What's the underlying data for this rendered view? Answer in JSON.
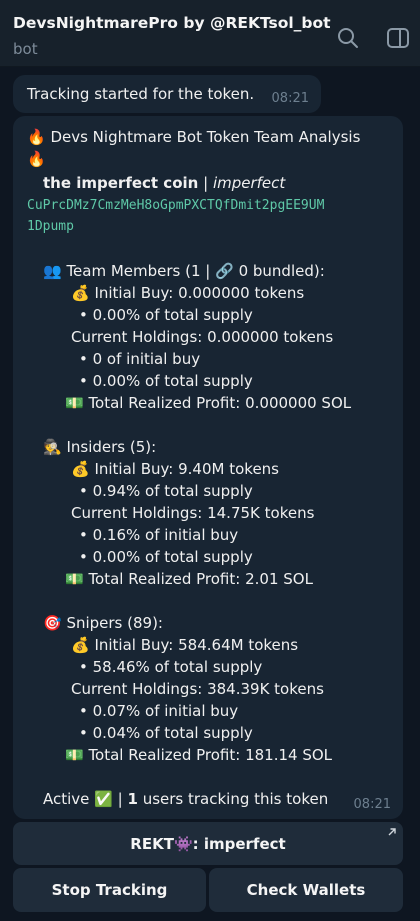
{
  "header": {
    "title": "DevsNightmarePro by @REKTsol_bot",
    "subtitle": "bot"
  },
  "messages": [
    {
      "text": "Tracking started for the token.",
      "time": "08:21"
    }
  ],
  "report": {
    "lines": [
      "🔥 Devs Nightmare Bot Token Team Analysis",
      "🔥",
      "",
      "",
      "",
      "",
      "",
      "👥 Team Members (1 | 🔗 0 bundled):",
      "💰 Initial Buy: 0.000000 tokens",
      "• 0.00% of total supply",
      "Current Holdings: 0.000000 tokens",
      "• 0 of initial buy",
      "• 0.00% of total supply",
      "💵 Total Realized Profit: 0.000000 SOL",
      "🕵 Insiders (5):",
      "💰 Initial Buy: 9.40M tokens",
      "• 0.94% of total supply",
      "Current Holdings: 14.75K tokens",
      "• 0.16% of initial buy",
      "• 0.00% of total supply",
      "💵 Total Realized Profit: 2.01 SOL",
      "🎯 Snipers (89):",
      "💰 Initial Buy: 584.64M tokens",
      "• 58.46% of total supply",
      "Current Holdings: 384.39K tokens",
      "• 0.07% of initial buy",
      "• 0.04% of total supply",
      "💵 Total Realized Profit: 181.14 SOL"
    ],
    "token_name": "the imperfect coin",
    "separator": "|",
    "token_symbol": "imperfect",
    "address_line1": "CuPrcDMz7CmzMeH8oGpmPXCTQfDmit2pgEE9UM",
    "address_line2": "1Dpump",
    "status_active": "Active ✅",
    "status_sep": "|",
    "status_users": "1",
    "status_rest": "users tracking this token",
    "time": "08:21"
  },
  "buttons": {
    "rekt": "REKT👾: imperfect",
    "stop": "Stop Tracking",
    "check": "Check Wallets"
  },
  "icons": [
    "search-icon",
    "panel-icon",
    "link-arrow-icon"
  ],
  "colors": {
    "background": "#0e1621",
    "header": "#17212b",
    "bubble": "#182533",
    "address": "#5fc9a8",
    "button": "#1f2c3a"
  }
}
